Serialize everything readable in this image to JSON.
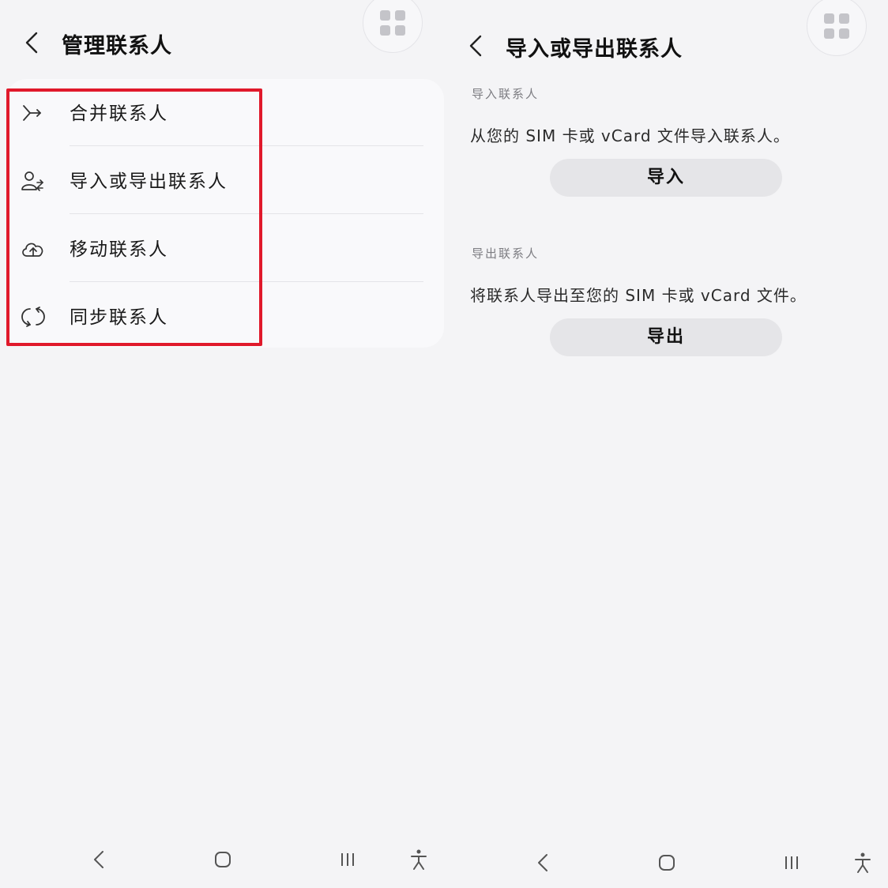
{
  "left_screen": {
    "title": "管理联系人",
    "icons": {
      "back": "chevron-left-icon",
      "apps": "grid-icon"
    },
    "menu": {
      "items": [
        {
          "label": "合并联系人",
          "icon": "merge-icon"
        },
        {
          "label": "导入或导出联系人",
          "icon": "person-transfer-icon"
        },
        {
          "label": "移动联系人",
          "icon": "cloud-upload-icon"
        },
        {
          "label": "同步联系人",
          "icon": "sync-icon"
        }
      ]
    },
    "highlight_color": "#e0192b"
  },
  "right_screen": {
    "title": "导入或导出联系人",
    "icons": {
      "back": "chevron-left-icon",
      "apps": "grid-icon"
    },
    "import_section": {
      "header": "导入联系人",
      "description": "从您的 SIM 卡或 vCard 文件导入联系人。",
      "button": "导入"
    },
    "export_section": {
      "header": "导出联系人",
      "description": "将联系人导出至您的 SIM 卡或 vCard 文件。",
      "button": "导出"
    }
  },
  "nav_bar": {
    "buttons": [
      "back-icon",
      "home-icon",
      "recents-icon",
      "accessibility-icon"
    ]
  }
}
